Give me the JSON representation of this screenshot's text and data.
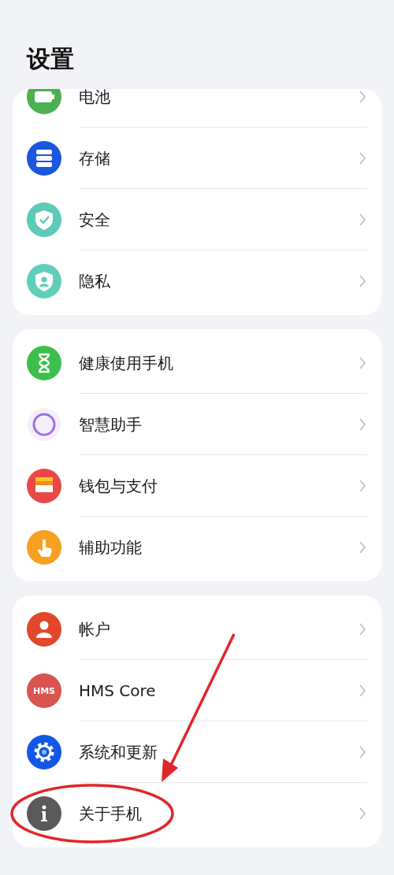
{
  "title": "设置",
  "groups": [
    {
      "items": [
        {
          "label": "电池",
          "kind": "battery",
          "color": "#4cb050",
          "circled": false
        },
        {
          "label": "存储",
          "kind": "storage",
          "color": "#1a56e0",
          "circled": false
        },
        {
          "label": "安全",
          "kind": "shield",
          "color": "#5ccab6",
          "circled": false
        },
        {
          "label": "隐私",
          "kind": "privacy",
          "color": "#5fcfba",
          "circled": false
        }
      ]
    },
    {
      "items": [
        {
          "label": "健康使用手机",
          "kind": "hourglass",
          "color": "#3dbf4c",
          "circled": false
        },
        {
          "label": "智慧助手",
          "kind": "ring",
          "color": "#a070e0",
          "circled": false
        },
        {
          "label": "钱包与支付",
          "kind": "wallet",
          "color": "#e84848",
          "circled": false
        },
        {
          "label": "辅助功能",
          "kind": "hand",
          "color": "#f5a021",
          "circled": false
        }
      ]
    },
    {
      "items": [
        {
          "label": "帐户",
          "kind": "person",
          "color": "#e2472c",
          "circled": false
        },
        {
          "label": "HMS Core",
          "kind": "text",
          "icon_text": "HMS",
          "color": "#d9534f",
          "circled": false
        },
        {
          "label": "系统和更新",
          "kind": "gear",
          "color": "#1158e8",
          "circled": false
        },
        {
          "label": "关于手机",
          "kind": "info",
          "color": "#5a5a5a",
          "circled": true
        }
      ]
    }
  ]
}
